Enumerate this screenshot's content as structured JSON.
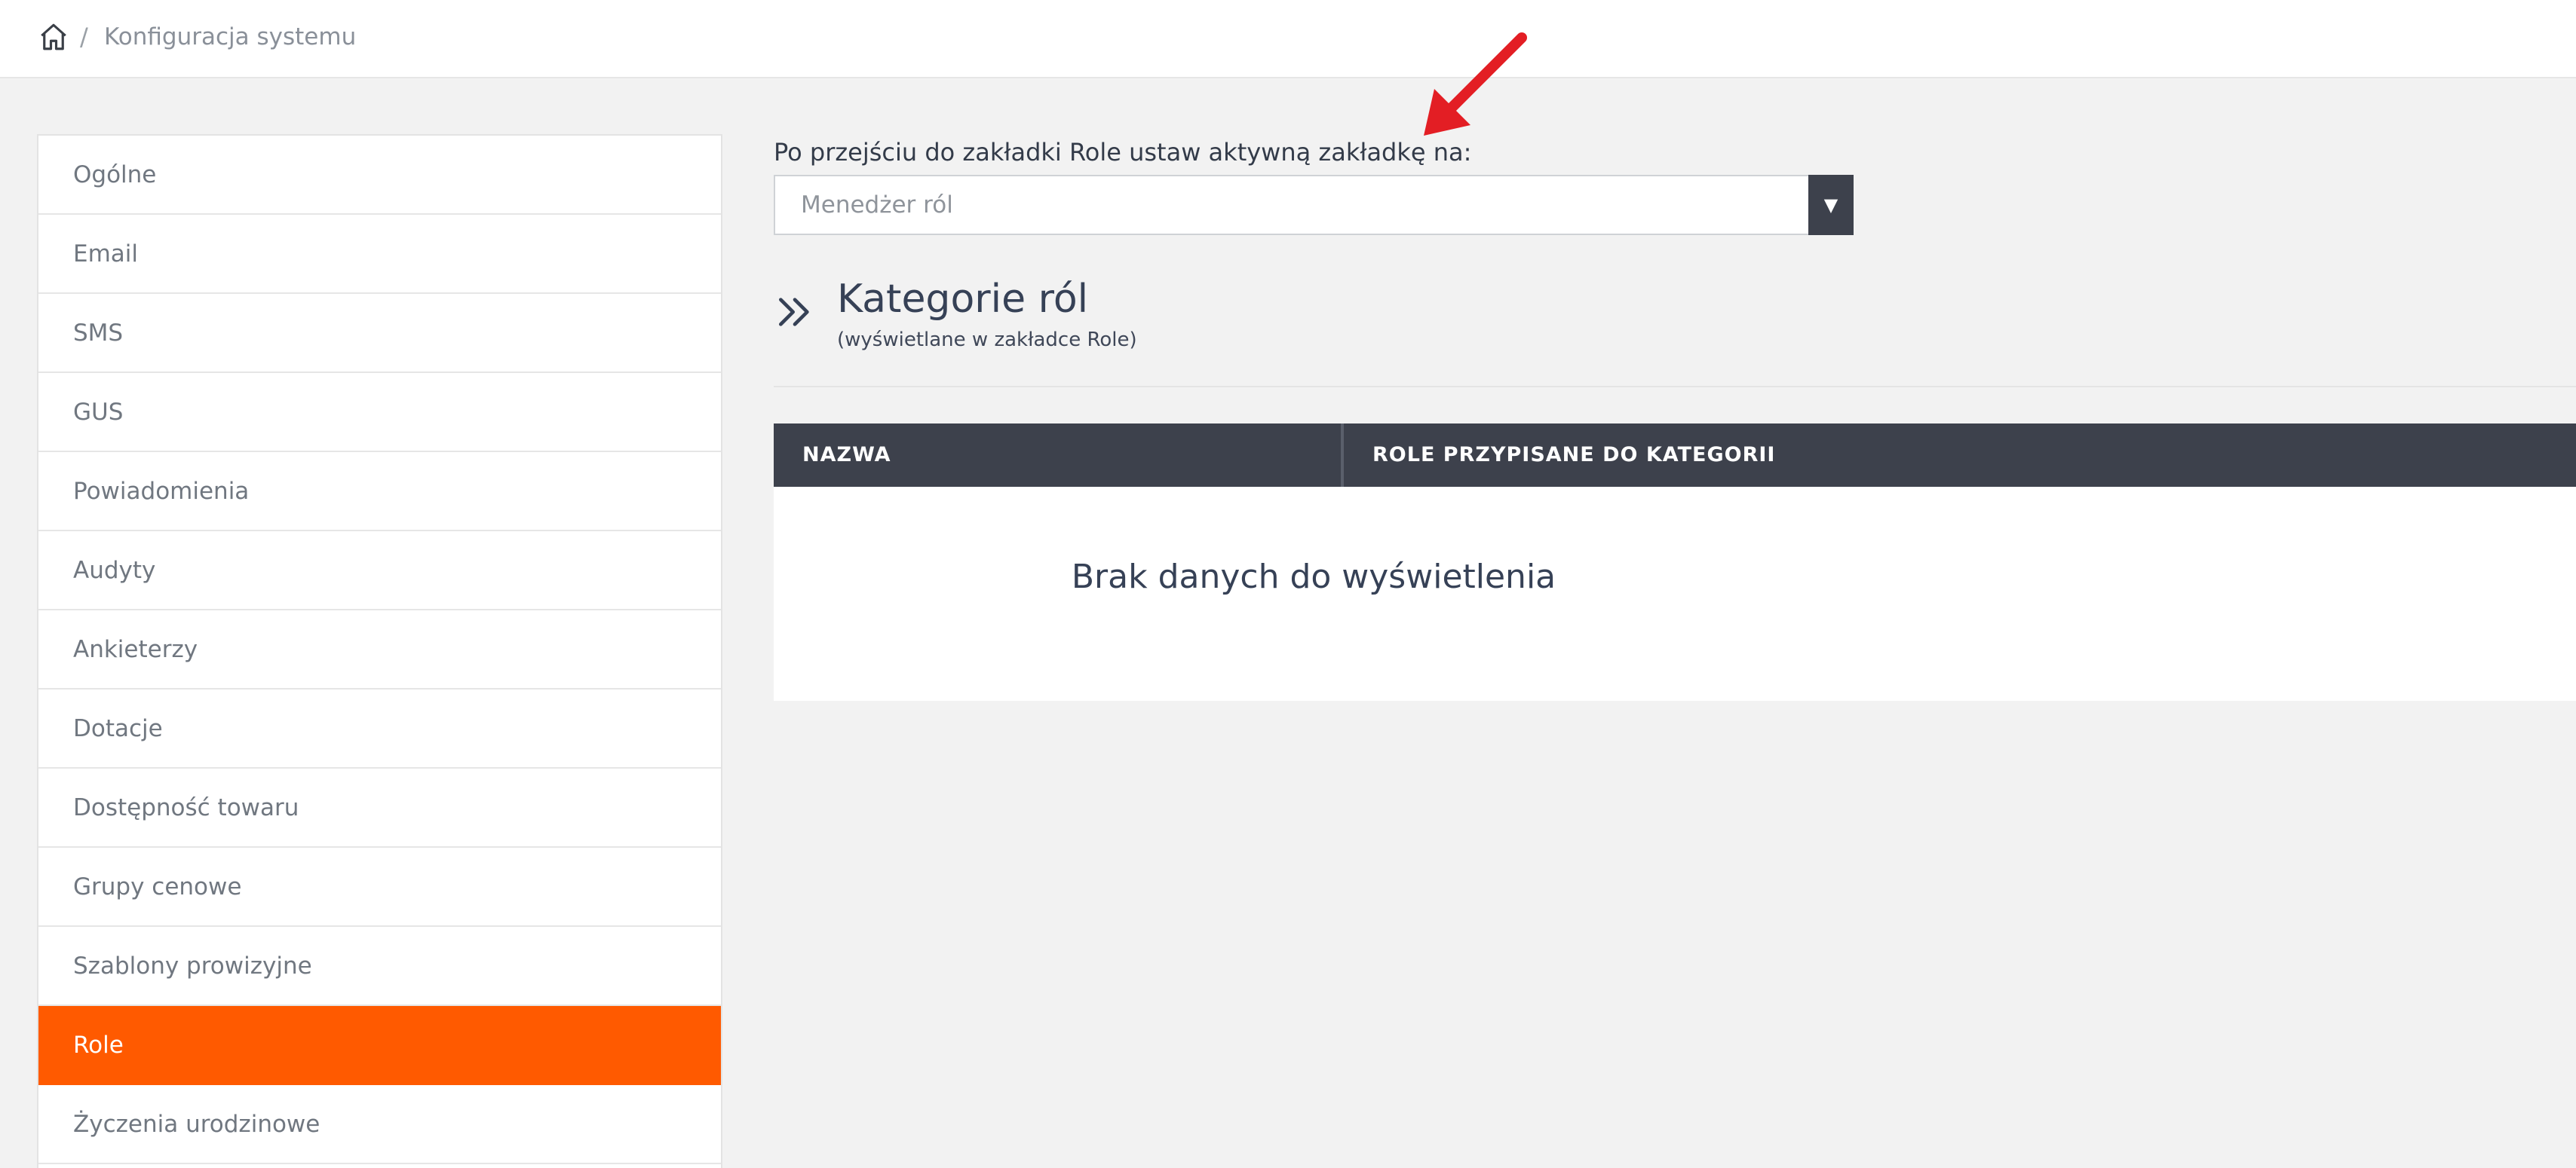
{
  "breadcrumb": {
    "separator": "/",
    "label": "Konfiguracja systemu",
    "home_icon": "home-icon"
  },
  "sidebar": {
    "items": [
      {
        "label": "Ogólne"
      },
      {
        "label": "Email"
      },
      {
        "label": "SMS"
      },
      {
        "label": "GUS"
      },
      {
        "label": "Powiadomienia"
      },
      {
        "label": "Audyty"
      },
      {
        "label": "Ankieterzy"
      },
      {
        "label": "Dotacje"
      },
      {
        "label": "Dostępność towaru"
      },
      {
        "label": "Grupy cenowe"
      },
      {
        "label": "Szablony prowizyjne"
      },
      {
        "label": "Role",
        "active": true
      },
      {
        "label": "Życzenia urodzinowe"
      }
    ],
    "active_color": "#ff5a00"
  },
  "settings": {
    "select_label": "Po przejściu do zakładki Role ustaw aktywną zakładkę na:",
    "select_value": "Menedżer ról",
    "select_arrow": "▼"
  },
  "section": {
    "icon": "double-chevron-right-icon",
    "title": "Kategorie ról",
    "subtitle": "(wyświetlane w zakładce Role)"
  },
  "table": {
    "columns": [
      "NAZWA",
      "ROLE PRZYPISANE DO KATEGORII"
    ],
    "empty_message": "Brak danych do wyświetlenia",
    "header_color": "#3d414c"
  },
  "annotation": {
    "icon": "red-arrow-icon",
    "color": "#e31e24"
  }
}
